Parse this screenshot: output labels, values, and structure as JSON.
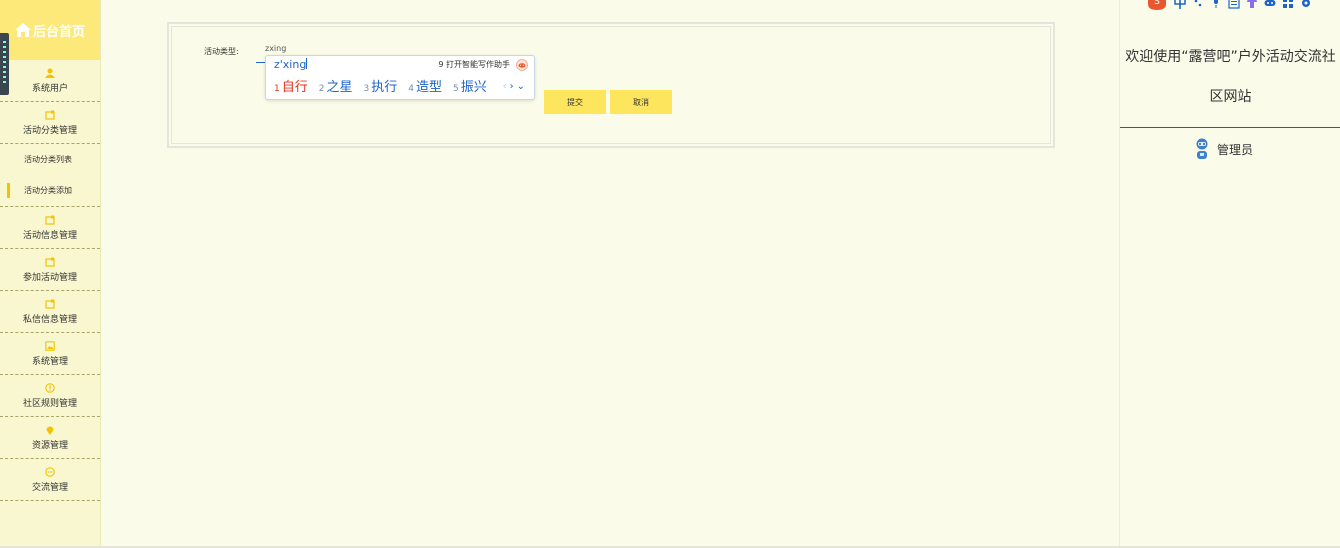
{
  "sidebar": {
    "home_label": "后台首页",
    "items": [
      {
        "label": "系统用户",
        "icon": "user-icon"
      },
      {
        "label": "活动分类管理",
        "icon": "folder-icon"
      },
      {
        "label": "活动分类列表"
      },
      {
        "label": "活动分类添加"
      },
      {
        "label": "活动信息管理",
        "icon": "folder-icon"
      },
      {
        "label": "参加活动管理",
        "icon": "folder-icon"
      },
      {
        "label": "私信信息管理",
        "icon": "folder-icon"
      },
      {
        "label": "系统管理",
        "icon": "image-icon"
      },
      {
        "label": "社区规则管理",
        "icon": "info-circle-icon"
      },
      {
        "label": "资源管理",
        "icon": "location-pin-icon"
      },
      {
        "label": "交流管理",
        "icon": "chat-icon"
      }
    ],
    "accent_color": "#fde87a"
  },
  "form": {
    "field_label": "活动类型:",
    "field_value": "zxing",
    "submit_label": "提交",
    "cancel_label": "取消",
    "button_color": "#fde65e"
  },
  "ime": {
    "composition": "z'xing",
    "assistant_label": "9 打开智能写作助手",
    "candidates": [
      {
        "num": "1",
        "text": "自行"
      },
      {
        "num": "2",
        "text": "之星"
      },
      {
        "num": "3",
        "text": "执行"
      },
      {
        "num": "4",
        "text": "造型"
      },
      {
        "num": "5",
        "text": "振兴"
      }
    ],
    "nav_prev": "‹",
    "nav_next": "›",
    "nav_more": "⌄"
  },
  "right_panel": {
    "welcome_line1": "欢迎使用“露营吧”户外活动交流社",
    "welcome_line2": "区网站",
    "admin_label": "管理员"
  }
}
